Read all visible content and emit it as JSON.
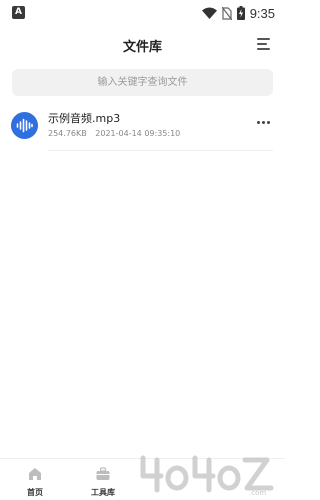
{
  "status_bar": {
    "left_badge": "A",
    "time": "9:35"
  },
  "header": {
    "title": "文件库"
  },
  "search": {
    "placeholder": "输入关键字查询文件"
  },
  "files": [
    {
      "name": "示例音频.mp3",
      "size": "254.76KB",
      "datetime": "2021-04-14 09:35:10",
      "icon": "audio-wave-icon"
    }
  ],
  "bottom_nav": {
    "items": [
      {
        "label": "首页",
        "icon": "home-icon"
      },
      {
        "label": "工具库",
        "icon": "toolbox-icon"
      }
    ]
  },
  "watermark": {
    "text": "4o4oZ.com"
  },
  "colors": {
    "accent": "#2f6fe0",
    "search_bg": "#f1f1f1"
  }
}
